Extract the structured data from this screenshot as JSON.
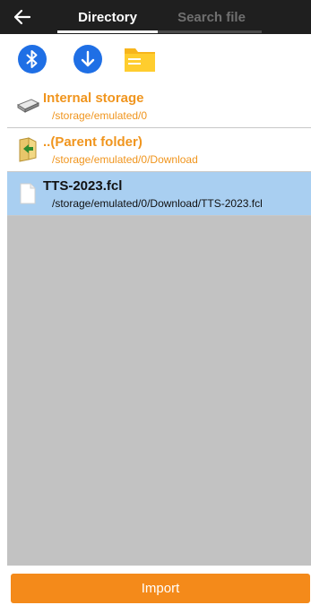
{
  "header": {
    "back_icon": "arrow-left-icon",
    "tabs": [
      {
        "label": "Directory",
        "active": true
      },
      {
        "label": "Search file",
        "active": false
      }
    ]
  },
  "toolbar": {
    "icons": [
      "bluetooth-icon",
      "download-icon",
      "folder-icon"
    ]
  },
  "list": {
    "items": [
      {
        "name": "Internal storage",
        "path": "/storage/emulated/0",
        "icon": "drive-icon",
        "selected": false
      },
      {
        "name": "..(Parent folder)",
        "path": "/storage/emulated/0/Download",
        "icon": "parent-folder-icon",
        "selected": false
      },
      {
        "name": "TTS-2023.fcl",
        "path": "/storage/emulated/0/Download/TTS-2023.fcl",
        "icon": "file-icon",
        "selected": true
      }
    ]
  },
  "footer": {
    "import_label": "Import"
  },
  "colors": {
    "accent": "#f48a1a",
    "blue": "#1f6fe5",
    "selected_row": "#a9cff1",
    "list_bg": "#c2c2c2",
    "header_bg": "#1f1f1f"
  }
}
